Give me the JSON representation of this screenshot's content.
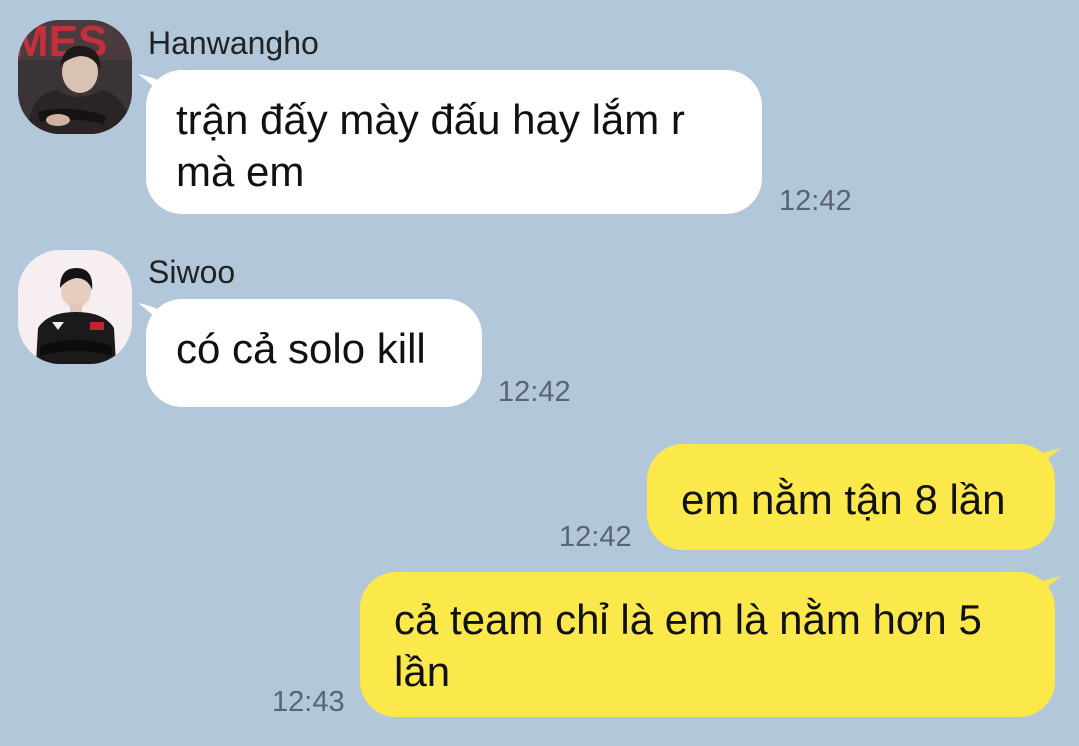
{
  "messages": [
    {
      "sender": "Hanwangho",
      "avatar": "hanwangho-avatar",
      "text": "trận đấy mày đấu hay lắm r mà em",
      "time": "12:42",
      "direction": "incoming"
    },
    {
      "sender": "Siwoo",
      "avatar": "siwoo-avatar",
      "text": "có cả solo kill",
      "time": "12:42",
      "direction": "incoming"
    },
    {
      "text": "em nằm tận 8 lần",
      "time": "12:42",
      "direction": "outgoing"
    },
    {
      "text": "cả team chỉ là em là nằm hơn 5 lần",
      "time": "12:43",
      "direction": "outgoing"
    }
  ],
  "avatar_overlay_text": "MES",
  "colors": {
    "background": "#b2c7da",
    "incoming_bubble": "#ffffff",
    "outgoing_bubble": "#fbe94b",
    "timestamp": "#5a6572"
  }
}
